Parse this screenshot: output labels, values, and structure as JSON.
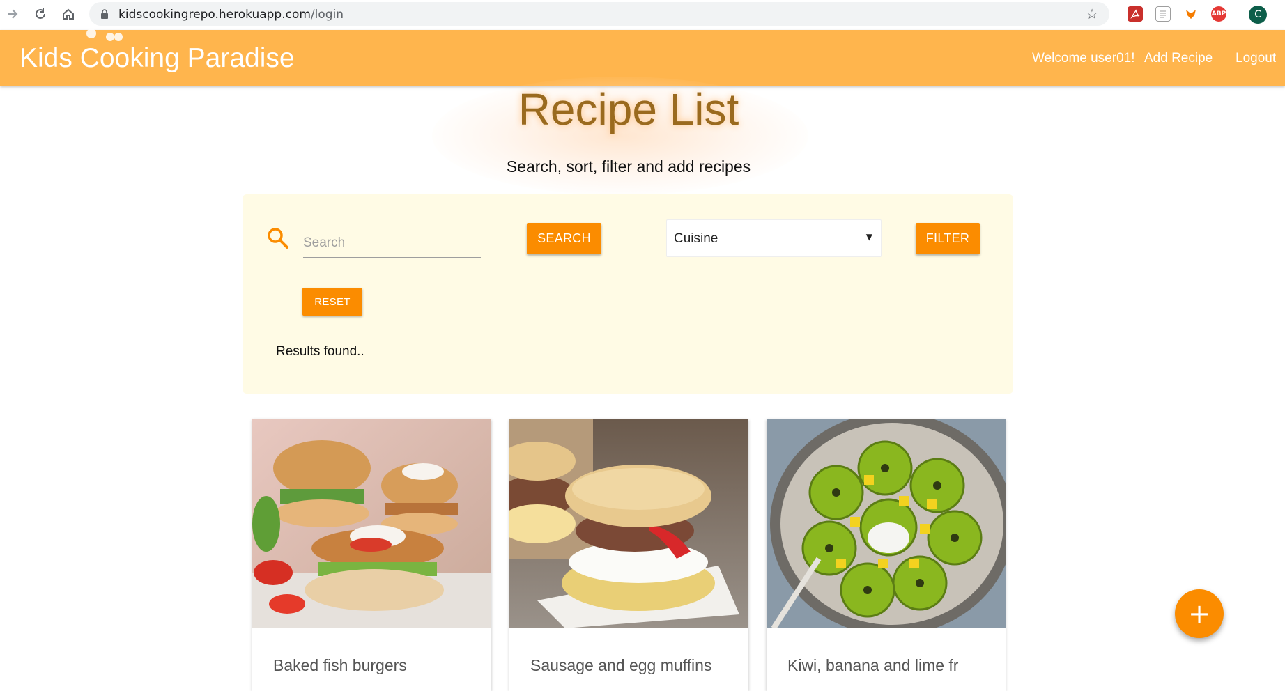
{
  "browser": {
    "url_host": "kidscookingrepo.herokuapp.com",
    "url_path": "/login",
    "extensions": [
      {
        "name": "pdf-extension-icon",
        "label": "",
        "color": "#c9302c"
      },
      {
        "name": "document-extension-icon",
        "label": "",
        "color": "#9e9e9e"
      },
      {
        "name": "fox-extension-icon",
        "label": "",
        "color": "#f57c00"
      },
      {
        "name": "adblock-extension-icon",
        "label": "ABP",
        "color": "#e53935"
      }
    ],
    "profile_initial": "C"
  },
  "header": {
    "brand": "Kids Cooking Paradise",
    "welcome": "Welcome user01!",
    "add_recipe": "Add Recipe",
    "logout": "Logout",
    "bg_color": "#ffb54d"
  },
  "hero": {
    "title": "Recipe List",
    "subtitle": "Search, sort, filter and add recipes"
  },
  "search": {
    "placeholder": "Search",
    "value": "",
    "search_button": "SEARCH",
    "cuisine_selected": "Cuisine",
    "filter_button": "FILTER",
    "reset_button": "RESET",
    "results_text": "Results found.."
  },
  "recipes": [
    {
      "name": "Baked fish burgers",
      "image": "fish-burger-photo"
    },
    {
      "name": "Sausage and egg muffins",
      "image": "sausage-egg-muffin-photo"
    },
    {
      "name": "Kiwi, banana and lime fr",
      "image": "kiwi-salad-photo"
    }
  ],
  "fab": {
    "icon": "plus-icon",
    "label": "+"
  },
  "colors": {
    "accent": "#fb8c00",
    "panel": "#fffbe5",
    "title": "#9a6a1e"
  }
}
